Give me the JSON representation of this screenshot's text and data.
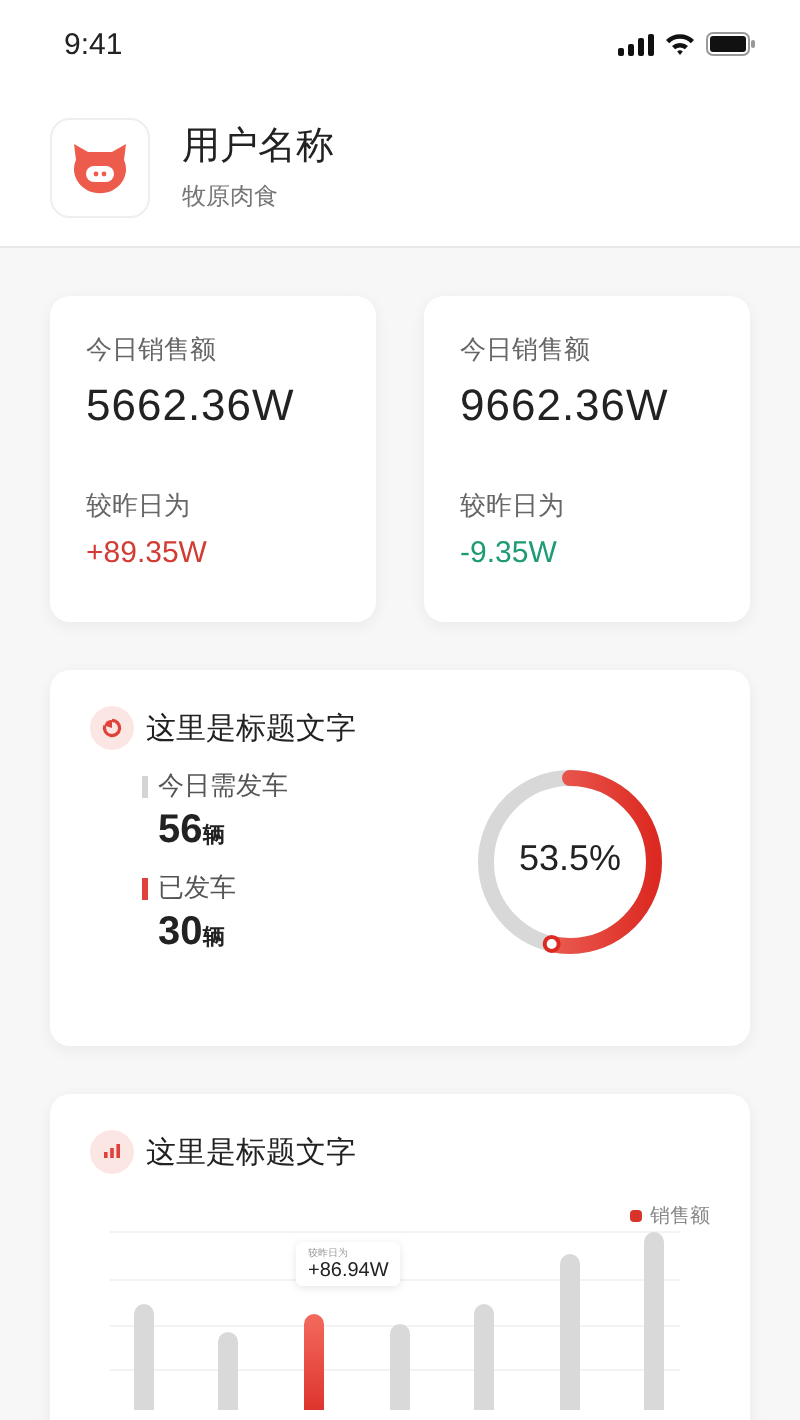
{
  "status_bar": {
    "time": "9:41"
  },
  "profile": {
    "name": "用户名称",
    "company": "牧原肉食"
  },
  "sales_cards": [
    {
      "label": "今日销售额",
      "value": "5662.36W",
      "compare_label": "较昨日为",
      "change": "+89.35W",
      "color": "#d23c34"
    },
    {
      "label": "今日销售额",
      "value": "9662.36W",
      "compare_label": "较昨日为",
      "change": "-9.35W",
      "color": "#1e9a74"
    }
  ],
  "dispatch_card": {
    "title": "这里是标题文字",
    "stats": [
      {
        "label": "今日需发车",
        "value": "56",
        "unit": "辆",
        "color": "#d4d4d4"
      },
      {
        "label": "已发车",
        "value": "30",
        "unit": "辆",
        "color": "#e0413a"
      }
    ],
    "progress": {
      "reading": "53.5%"
    }
  },
  "sales_chart_card": {
    "title": "这里是标题文字",
    "legend": "销售额",
    "tooltip": {
      "label": "较昨日为",
      "value": "+86.94W"
    }
  }
}
